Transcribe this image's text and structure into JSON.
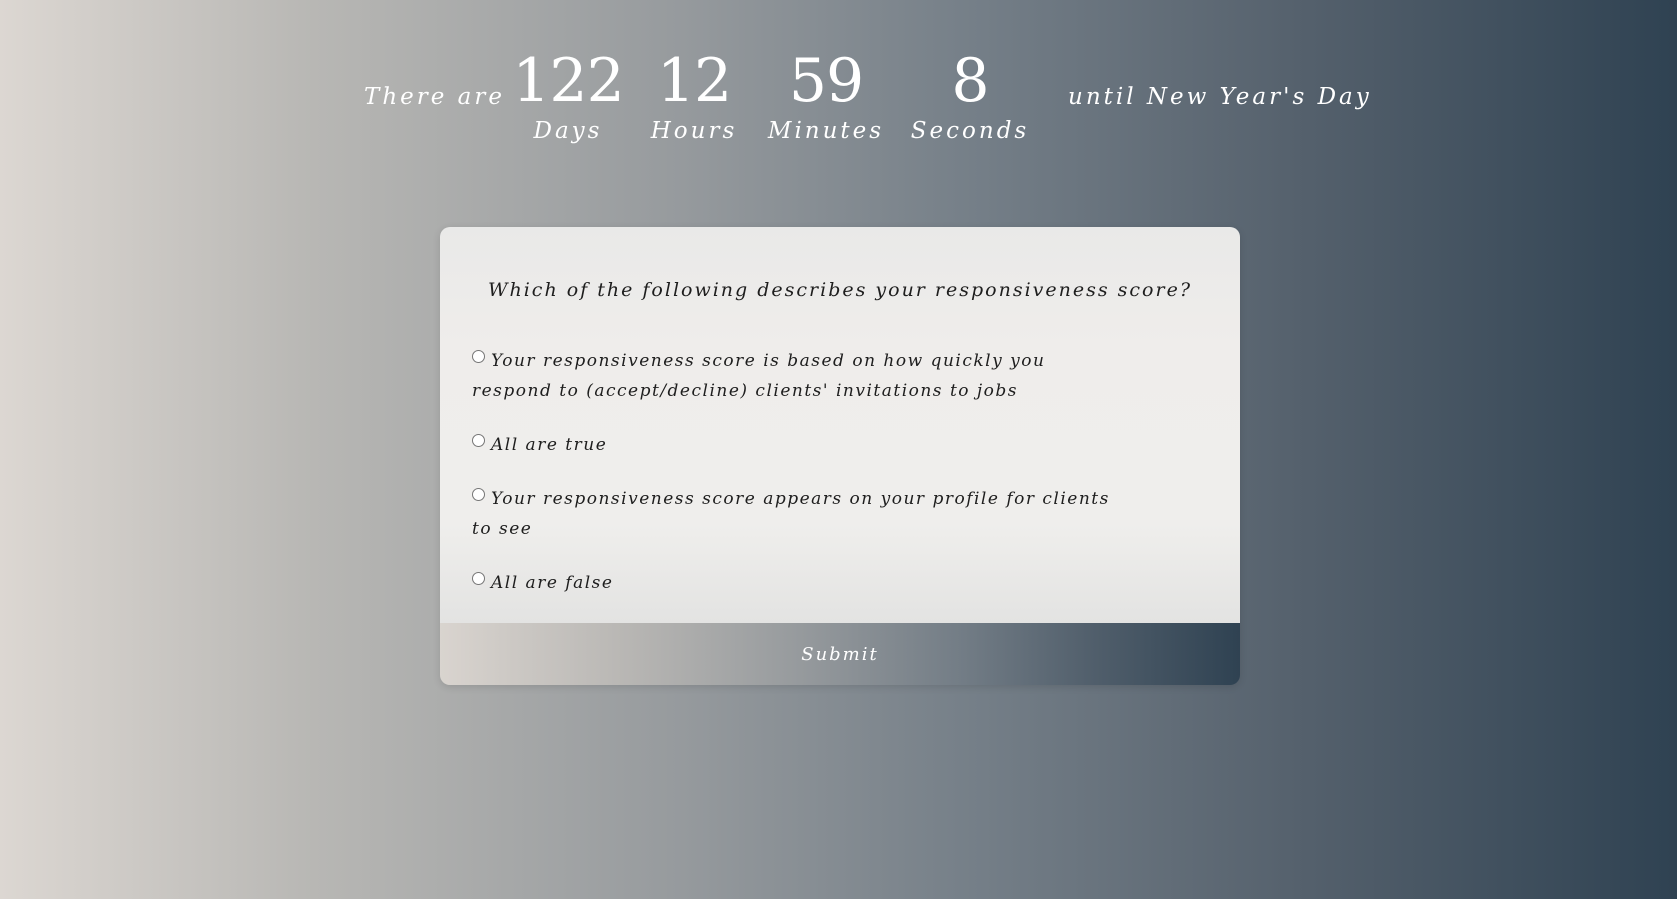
{
  "countdown": {
    "prefix": "There are",
    "suffix": "until New Year's Day",
    "units": [
      {
        "value": "122",
        "label": "Days"
      },
      {
        "value": "12",
        "label": "Hours"
      },
      {
        "value": "59",
        "label": "Minutes"
      },
      {
        "value": "8",
        "label": "Seconds"
      }
    ]
  },
  "quiz": {
    "question": "Which of the following describes your responsiveness score?",
    "options": [
      {
        "label": "Your responsiveness score is based on how quickly you respond to (accept/decline) clients' invitations to jobs",
        "selected": false
      },
      {
        "label": "All are true",
        "selected": false
      },
      {
        "label": "Your responsiveness score appears on your profile for clients to see",
        "selected": false
      },
      {
        "label": "All are false",
        "selected": false
      }
    ],
    "submit_label": "Submit"
  },
  "colors": {
    "gradient_start": "#dcd7d2",
    "gradient_end": "#2f4252",
    "card_background": "#efedeb",
    "text_dark": "#1e1e1e",
    "text_light": "#ffffff"
  }
}
